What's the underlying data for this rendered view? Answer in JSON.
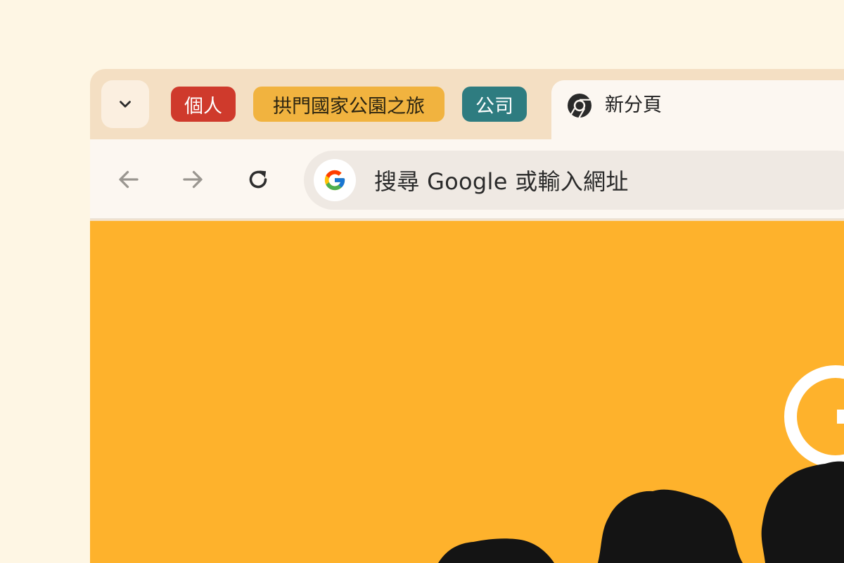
{
  "tab_strip": {
    "groups": [
      {
        "label": "個人",
        "color": "#cf3a2c"
      },
      {
        "label": "拱門國家公園之旅",
        "color": "#f1b33f"
      },
      {
        "label": "公司",
        "color": "#2e7c80"
      }
    ],
    "active_tab": {
      "title": "新分頁",
      "favicon": "chrome-icon"
    },
    "tab_search_icon": "chevron-down-icon"
  },
  "toolbar": {
    "back_icon": "arrow-left-icon",
    "forward_icon": "arrow-right-icon",
    "reload_icon": "reload-icon",
    "omnibox": {
      "placeholder": "搜尋 Google 或輸入網址",
      "icon": "google-g-icon"
    }
  },
  "content": {
    "background": "#feb22c",
    "description_icon": "google-doodle-icon"
  },
  "colors": {
    "page_background": "#fef6e4",
    "frame": "#f4dfc3",
    "toolbar": "#fcf7f1",
    "omnibox": "#efe9e3"
  }
}
